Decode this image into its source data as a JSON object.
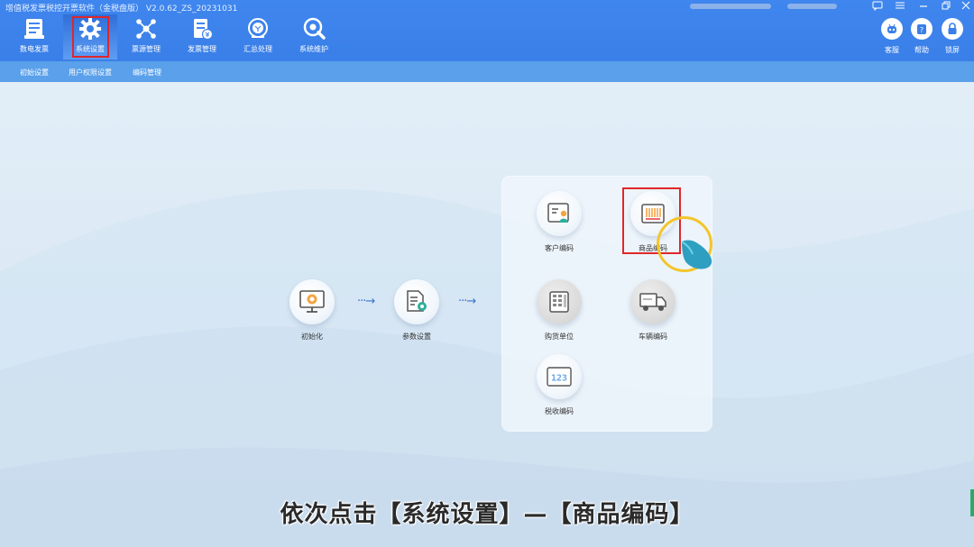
{
  "app": {
    "title": "增值税发票税控开票软件（金税盘版）  V2.0.62_ZS_20231031"
  },
  "toolbar": {
    "items": [
      {
        "label": "数电发票",
        "icon": "invoice-icon"
      },
      {
        "label": "系统设置",
        "icon": "gear-icon"
      },
      {
        "label": "票源管理",
        "icon": "network-icon"
      },
      {
        "label": "发票管理",
        "icon": "document-icon"
      },
      {
        "label": "汇总处理",
        "icon": "summary-icon"
      },
      {
        "label": "系统维护",
        "icon": "wrench-icon"
      }
    ],
    "right_buttons": [
      {
        "label": "客服",
        "icon": "robot-icon"
      },
      {
        "label": "帮助",
        "icon": "help-icon"
      },
      {
        "label": "锁屏",
        "icon": "lock-icon"
      }
    ],
    "window_controls": [
      "chat-icon",
      "menu-icon",
      "minimize-icon",
      "restore-icon",
      "close-icon"
    ]
  },
  "subnav": {
    "items": [
      "初始设置",
      "用户权限设置",
      "编码管理"
    ]
  },
  "flow": {
    "steps": [
      {
        "label": "初始化",
        "icon": "monitor-icon"
      },
      {
        "label": "参数设置",
        "icon": "doc-gear-icon"
      }
    ],
    "arrow": "···→"
  },
  "panel": {
    "items": [
      {
        "label": "客户编码",
        "icon": "customer-card-icon"
      },
      {
        "label": "商品编码",
        "icon": "barcode-icon"
      },
      {
        "label": "购货单位",
        "icon": "building-icon"
      },
      {
        "label": "车辆编码",
        "icon": "truck-icon"
      },
      {
        "label": "税收编码",
        "icon": "numbers-icon"
      }
    ],
    "numbers_glyph": "123"
  },
  "subtitle": "依次点击【系统设置】—【商品编码】",
  "colors": {
    "toolbar": "#3f86ee",
    "subnav": "#5aa0ea",
    "highlight": "#e0262a",
    "cursor_ring": "#f4c52a",
    "cursor_hand": "#2e9fc0"
  }
}
